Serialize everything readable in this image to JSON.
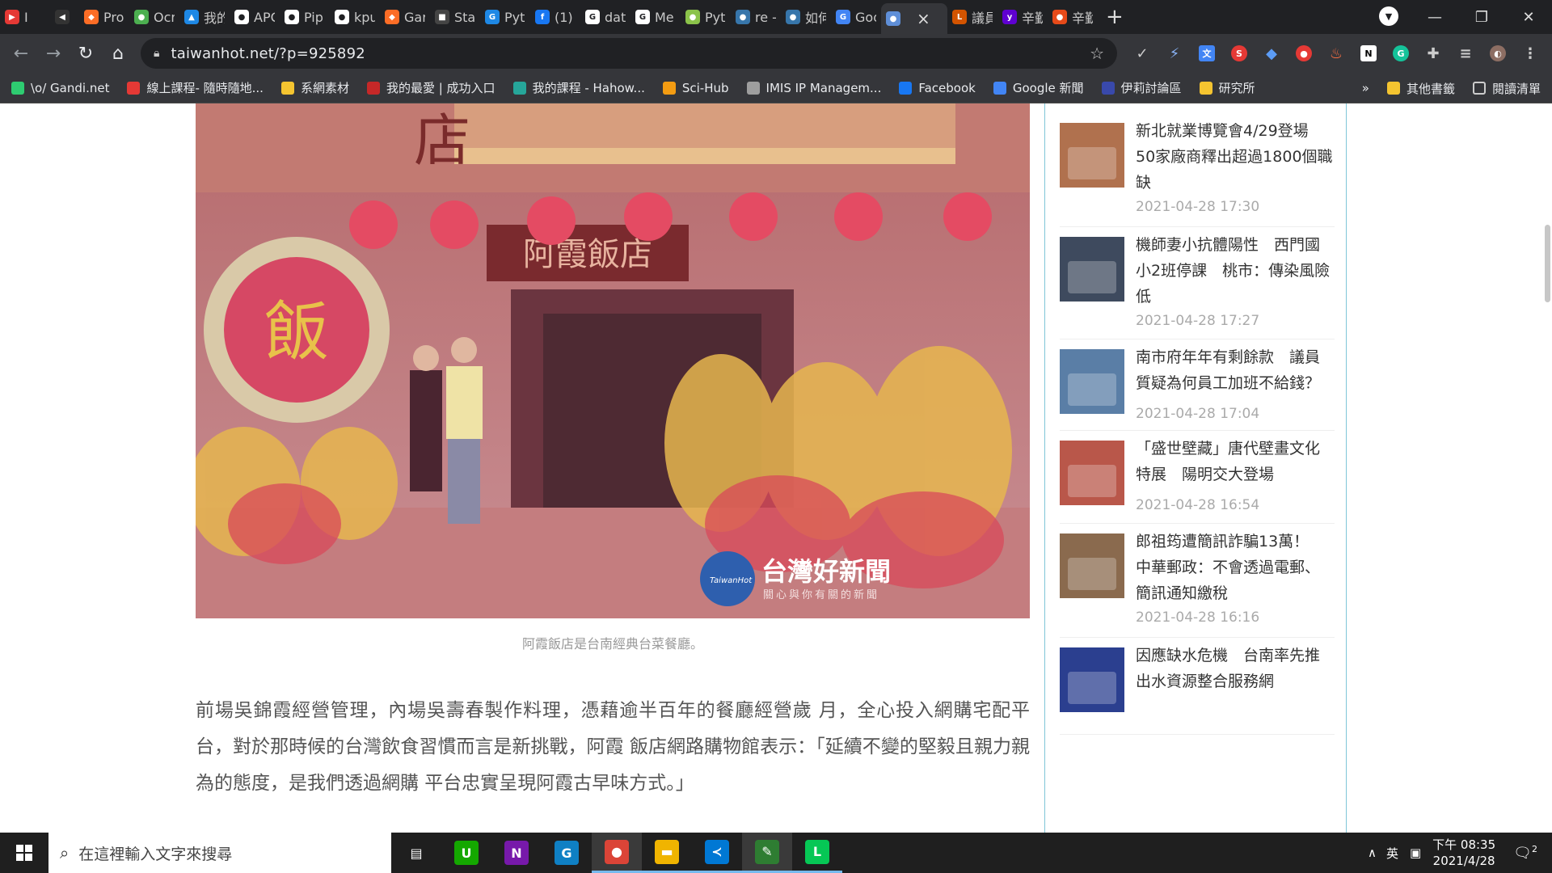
{
  "browser": {
    "tabs": [
      {
        "label": "I",
        "color": "#e53935",
        "glyph": "▶"
      },
      {
        "label": "",
        "color": "#333333",
        "glyph": "◀"
      },
      {
        "label": "Pro",
        "color": "#fc6d26",
        "glyph": "◆"
      },
      {
        "label": "Ocr",
        "color": "#4caf50",
        "glyph": "●"
      },
      {
        "label": "我的",
        "color": "#1e88e5",
        "glyph": "▲"
      },
      {
        "label": "APC",
        "color": "#ffffff",
        "glyph": "●"
      },
      {
        "label": "Pip",
        "color": "#ffffff",
        "glyph": "●"
      },
      {
        "label": "kpu",
        "color": "#ffffff",
        "glyph": "●"
      },
      {
        "label": "Gar",
        "color": "#fc6d26",
        "glyph": "◆"
      },
      {
        "label": "Sta",
        "color": "#444444",
        "glyph": "■"
      },
      {
        "label": "Pyt",
        "color": "#1e88e5",
        "glyph": "G"
      },
      {
        "label": "(1) I",
        "color": "#1877f2",
        "glyph": "f"
      },
      {
        "label": "dat",
        "color": "#ffffff",
        "glyph": "G"
      },
      {
        "label": "Me",
        "color": "#ffffff",
        "glyph": "G"
      },
      {
        "label": "Pyt",
        "color": "#8bc34a",
        "glyph": "●"
      },
      {
        "label": "re -",
        "color": "#3776ab",
        "glyph": "●"
      },
      {
        "label": "如何",
        "color": "#3776ab",
        "glyph": "●"
      },
      {
        "label": "Goo",
        "color": "#4285f4",
        "glyph": "G"
      },
      {
        "label": "",
        "color": "#5f8fd8",
        "glyph": "●",
        "active": true
      },
      {
        "label": "議員",
        "color": "#d35400",
        "glyph": "L"
      },
      {
        "label": "辛勤",
        "color": "#5f01d1",
        "glyph": "y"
      },
      {
        "label": "辛勤",
        "color": "#e64a19",
        "glyph": "●"
      }
    ],
    "url": "taiwanhot.net/?p=925892",
    "bookmarks": [
      {
        "label": "\\o/ Gandi.net",
        "color": "#2ecc71"
      },
      {
        "label": "線上課程- 隨時隨地...",
        "color": "#e53935"
      },
      {
        "label": "系網素材",
        "color": "#f4c430"
      },
      {
        "label": "我的最愛 | 成功入口",
        "color": "#c62828"
      },
      {
        "label": "我的課程 - Hahow...",
        "color": "#26a69a"
      },
      {
        "label": "Sci-Hub",
        "color": "#f39c12"
      },
      {
        "label": "IMIS IP Managem...",
        "color": "#9e9e9e"
      },
      {
        "label": "Facebook",
        "color": "#1877f2"
      },
      {
        "label": "Google 新聞",
        "color": "#4285f4"
      },
      {
        "label": "伊莉討論區",
        "color": "#3949ab"
      },
      {
        "label": "研究所",
        "color": "#f4c430"
      }
    ],
    "more": "»",
    "other_bookmarks": "其他書籤",
    "reading_list": "閱讀清單"
  },
  "article": {
    "caption": "阿霞飯店是台南經典台菜餐廳。",
    "paragraph": "前場吳錦霞經營管理，內場吳壽春製作料理，憑藉逾半百年的餐廳經營歲 月，全心投入網購宅配平台，對於那時候的台灣飲食習慣而言是新挑戰，阿霞 飯店網路購物館表示：「延續不變的堅毅且親力親為的態度，是我們透過網購 平台忠實呈現阿霞古早味方式。」",
    "photo": {
      "sign": "阿霞飯店",
      "sign_left": "店",
      "wreath_char": "飯",
      "watermark_title": "台灣好新聞",
      "watermark_sub": "關心與你有關的新聞",
      "watermark_logo": "TaiwanHot"
    }
  },
  "sidebar": {
    "items": [
      {
        "title": "新北就業博覽會4/29登場　50家廠商釋出超過1800個職缺",
        "time": "2021-04-28 17:30",
        "thumb": "#b0714e"
      },
      {
        "title": "機師妻小抗體陽性　西門國小2班停課　桃市：傳染風險低",
        "time": "2021-04-28 17:27",
        "thumb": "#3e4a5e"
      },
      {
        "title": "南市府年年有剩餘款　議員質疑為何員工加班不給錢？",
        "time": "2021-04-28 17:04",
        "thumb": "#5a7ea6"
      },
      {
        "title": "「盛世壁藏」唐代壁畫文化特展　陽明交大登場",
        "time": "2021-04-28 16:54",
        "thumb": "#b9574a"
      },
      {
        "title": "郎祖筠遭簡訊詐騙13萬！　中華郵政：不會透過電郵、簡訊通知繳稅",
        "time": "2021-04-28 16:16",
        "thumb": "#8a6a4e"
      },
      {
        "title": "因應缺水危機　台南率先推出水資源整合服務網",
        "time": "",
        "thumb": "#2b3f8f"
      }
    ]
  },
  "taskbar": {
    "search_placeholder": "在這裡輸入文字來搜尋",
    "ime": "英",
    "time": "下午 08:35",
    "date": "2021/4/28",
    "notifications": "2",
    "apps": [
      {
        "name": "task-view",
        "glyph": "▤",
        "color": "#1f1f1f"
      },
      {
        "name": "upwork",
        "glyph": "U",
        "color": "#14a800"
      },
      {
        "name": "onenote",
        "glyph": "N",
        "color": "#7719aa"
      },
      {
        "name": "grammarly-app",
        "glyph": "G",
        "color": "#0f80c4"
      },
      {
        "name": "chrome",
        "glyph": "●",
        "color": "#db4437"
      },
      {
        "name": "file-explorer",
        "glyph": "▬",
        "color": "#f0b400"
      },
      {
        "name": "vscode",
        "glyph": "≺",
        "color": "#0078d4"
      },
      {
        "name": "editor-app",
        "glyph": "✎",
        "color": "#2e7d32"
      },
      {
        "name": "line",
        "glyph": "L",
        "color": "#06c755"
      }
    ]
  }
}
